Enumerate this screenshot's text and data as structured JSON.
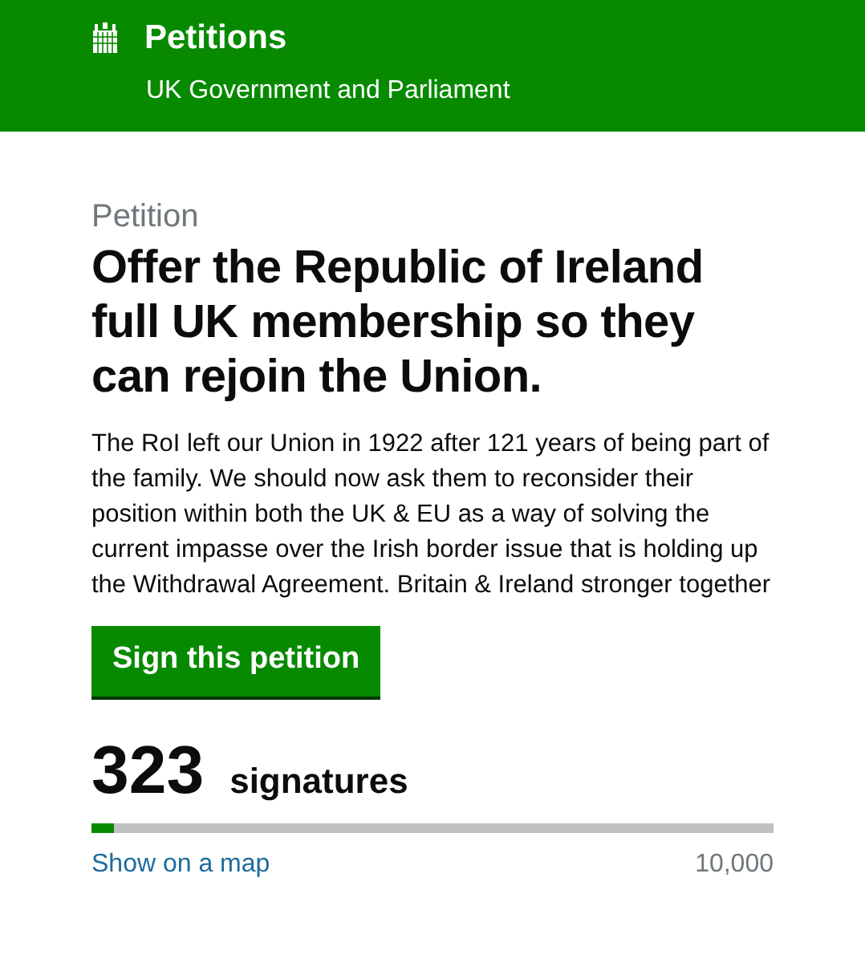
{
  "header": {
    "title": "Petitions",
    "subtitle": "UK Government and Parliament"
  },
  "petition": {
    "label": "Petition",
    "title": "Offer the Republic of Ireland full UK membership so they can rejoin the Union.",
    "body": "The RoI left our Union in 1922 after 121 years of being part of the family. We should now ask them to reconsider their position within both the UK & EU as a way of solving the current impasse over the Irish border issue that is holding up the Withdrawal Agreement. Britain & Ireland stronger together",
    "button": "Sign this petition"
  },
  "signatures": {
    "count": "323",
    "label": "signatures",
    "level": 0.0323,
    "map_link": "Show on a map",
    "target": "10,000"
  }
}
